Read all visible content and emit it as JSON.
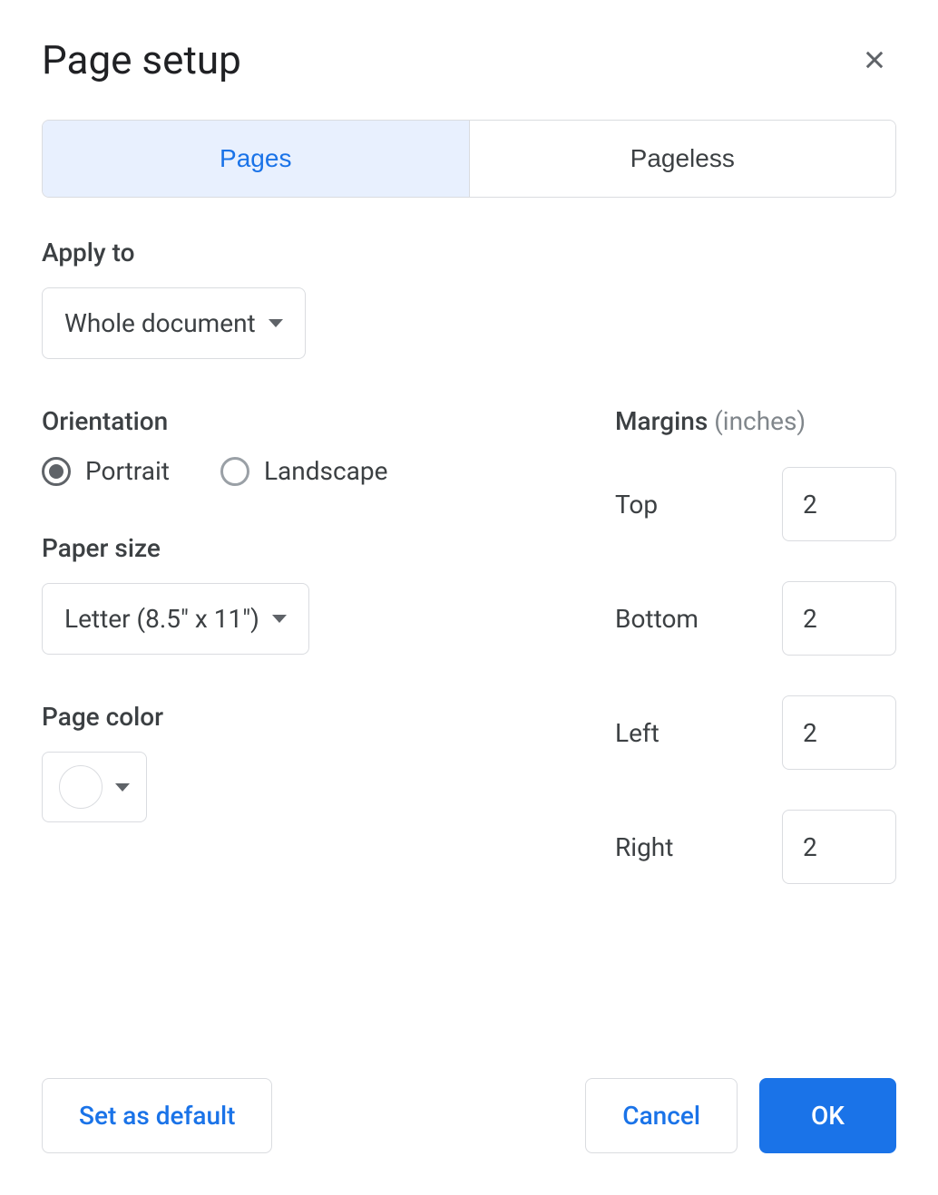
{
  "dialog": {
    "title": "Page setup",
    "tabs": {
      "pages": "Pages",
      "pageless": "Pageless",
      "active": "pages"
    },
    "apply_to": {
      "label": "Apply to",
      "value": "Whole document"
    },
    "orientation": {
      "label": "Orientation",
      "options": {
        "portrait": "Portrait",
        "landscape": "Landscape"
      },
      "selected": "portrait"
    },
    "paper_size": {
      "label": "Paper size",
      "value": "Letter (8.5\" x 11\")"
    },
    "page_color": {
      "label": "Page color",
      "value": "#ffffff"
    },
    "margins": {
      "label": "Margins",
      "unit": "(inches)",
      "top": {
        "label": "Top",
        "value": "2"
      },
      "bottom": {
        "label": "Bottom",
        "value": "2"
      },
      "left": {
        "label": "Left",
        "value": "2"
      },
      "right": {
        "label": "Right",
        "value": "2"
      }
    },
    "buttons": {
      "set_default": "Set as default",
      "cancel": "Cancel",
      "ok": "OK"
    }
  }
}
